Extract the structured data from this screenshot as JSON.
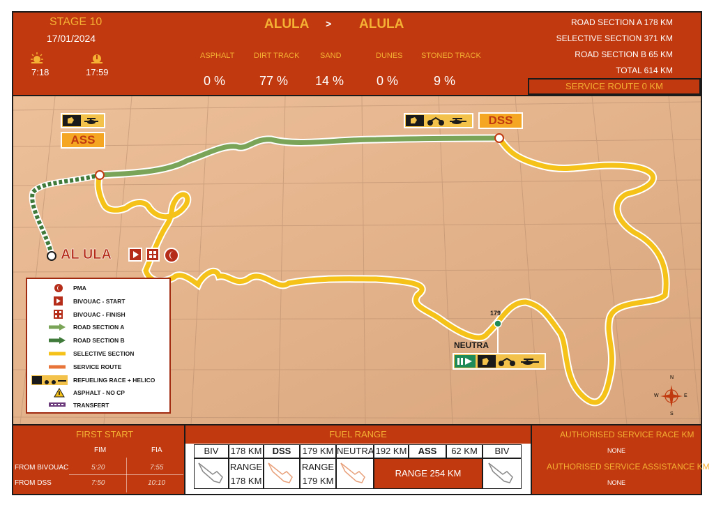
{
  "header": {
    "stage": "STAGE 10",
    "date": "17/01/2024",
    "sunrise_time": "7:18",
    "sunset_time": "17:59",
    "from": "ALULA",
    "arrow": ">",
    "to": "ALULA",
    "surfaces": [
      {
        "label": "ASPHALT",
        "value": "0 %"
      },
      {
        "label": "DIRT TRACK",
        "value": "77 %"
      },
      {
        "label": "SAND",
        "value": "14 %"
      },
      {
        "label": "DUNES",
        "value": "0 %"
      },
      {
        "label": "STONED TRACK",
        "value": "9 %"
      }
    ],
    "distances": [
      "ROAD SECTION A  178 KM",
      "SELECTIVE SECTION  371 KM",
      "ROAD SECTION B  65 KM",
      "TOTAL  614 KM"
    ],
    "service_route": "SERVICE ROUTE  0 KM"
  },
  "map": {
    "start_label": "AL ULA",
    "ass_label": "ASS",
    "dss_label": "DSS",
    "neutra_label": "NEUTRA",
    "neutra_km": "179",
    "compass": {
      "n": "N",
      "s": "S",
      "e": "E",
      "w": "W"
    },
    "colors": {
      "road_a": "#7aa457",
      "road_b": "#3f7a3a",
      "selective": "#f5c21a",
      "service": "#e8743a",
      "accent": "#c0390f"
    }
  },
  "legend": [
    {
      "icon": "pma-icon",
      "label": "PMA"
    },
    {
      "icon": "bivouac-start-icon",
      "label": "BIVOUAC - START"
    },
    {
      "icon": "bivouac-finish-icon",
      "label": "BIVOUAC - FINISH"
    },
    {
      "icon": "road-section-a-icon",
      "label": "ROAD SECTION A"
    },
    {
      "icon": "road-section-b-icon",
      "label": "ROAD SECTION B"
    },
    {
      "icon": "selective-section-icon",
      "label": "SELECTIVE SECTION"
    },
    {
      "icon": "service-route-icon",
      "label": "SERVICE ROUTE"
    },
    {
      "icon": "refueling-icon",
      "label": "REFUELING RACE + HELICO"
    },
    {
      "icon": "warning-icon",
      "label": "ASPHALT - NO CP"
    },
    {
      "icon": "transfert-icon",
      "label": "TRANSFERT"
    }
  ],
  "first_start": {
    "title": "FIRST START",
    "col_fim": "FIM",
    "col_fia": "FIA",
    "row1_label": "FROM BIVOUAC",
    "row1_fim": "5:20",
    "row1_fia": "7:55",
    "row2_label": "FROM DSS",
    "row2_fim": "7:50",
    "row2_fia": "10:10"
  },
  "fuel": {
    "title": "FUEL RANGE",
    "cells": [
      "BIV",
      "178 KM",
      "DSS",
      "179 KM",
      "NEUTRA",
      "192 KM",
      "ASS",
      "62 KM",
      "BIV"
    ],
    "range1": "RANGE",
    "range1_km": "178 KM",
    "range2": "RANGE",
    "range2_km": "179 KM",
    "range3": "RANGE 254 KM"
  },
  "service": {
    "race_title": "AUTHORISED SERVICE RACE KM",
    "race_value": "NONE",
    "assist_title": "AUTHORISED SERVICE ASSISTANCE KM",
    "assist_value": "NONE"
  }
}
